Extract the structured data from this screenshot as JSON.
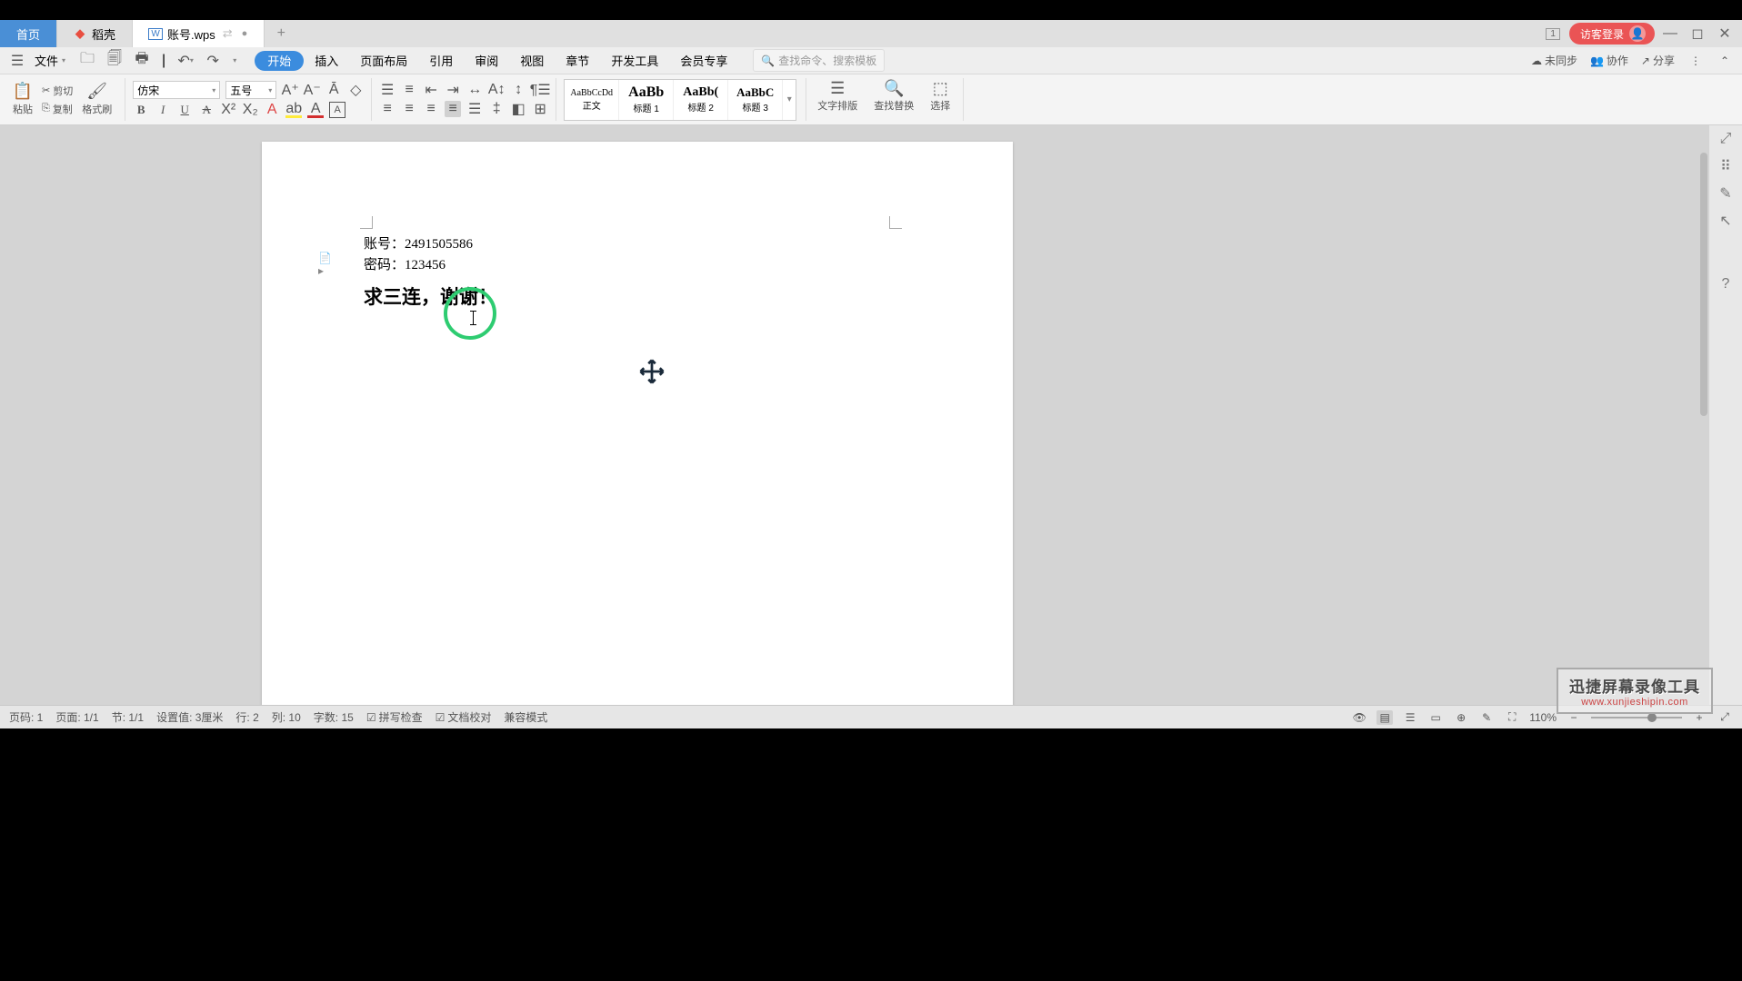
{
  "tabs": {
    "home": "首页",
    "doke": "稻壳",
    "doc": "账号.wps"
  },
  "titlebar": {
    "login": "访客登录",
    "badge": "1"
  },
  "menu": {
    "file": "文件",
    "search_placeholder": "查找命令、搜索模板"
  },
  "ribbon_tabs": [
    "开始",
    "插入",
    "页面布局",
    "引用",
    "审阅",
    "视图",
    "章节",
    "开发工具",
    "会员专享"
  ],
  "menubar_right": {
    "unsync": "未同步",
    "coop": "协作",
    "share": "分享"
  },
  "toolbar": {
    "paste": "粘贴",
    "cut": "剪切",
    "copy": "复制",
    "format_painter": "格式刷",
    "font_name": "仿宋",
    "font_size": "五号",
    "styles": {
      "s1": {
        "preview": "AaBbCcDd",
        "label": "正文"
      },
      "s2": {
        "preview": "AaBb",
        "label": "标题 1"
      },
      "s3": {
        "preview": "AaBb(",
        "label": "标题 2"
      },
      "s4": {
        "preview": "AaBbC",
        "label": "标题 3"
      }
    },
    "text_layout": "文字排版",
    "find_replace": "查找替换",
    "select": "选择"
  },
  "document": {
    "line1": "账号：2491505586",
    "line2": "密码：123456",
    "line3": "求三连，谢谢！"
  },
  "status": {
    "page_code": "页码: 1",
    "pages": "页面: 1/1",
    "section": "节: 1/1",
    "setting": "设置值: 3厘米",
    "row": "行: 2",
    "col": "列: 10",
    "words": "字数: 15",
    "spell": "拼写检查",
    "proof": "文档校对",
    "compat": "兼容模式",
    "zoom": "110%"
  },
  "watermark": {
    "title": "迅捷屏幕录像工具",
    "url": "www.xunjieshipin.com"
  }
}
